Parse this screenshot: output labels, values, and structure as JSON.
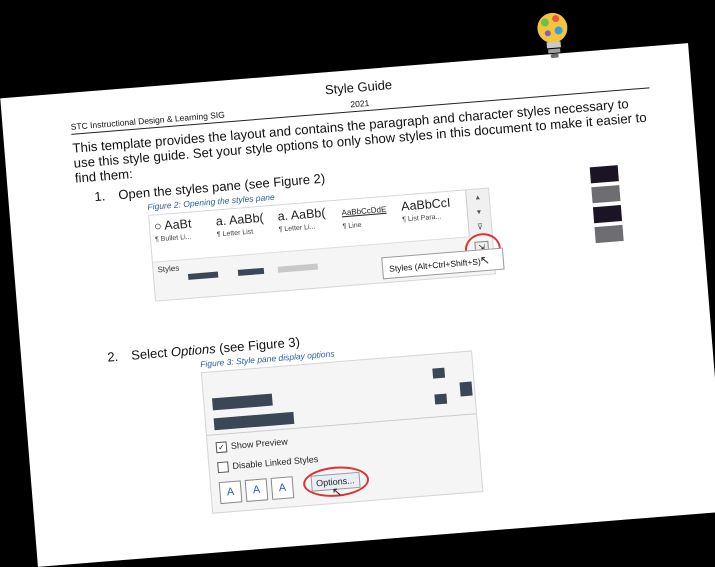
{
  "header": {
    "title": "Style Guide",
    "org": "STC Instructional Design & Learning SIG",
    "year": "2021"
  },
  "intro": "This template provides the layout and contains the paragraph and character styles necessary to use this style guide. Set your style options to only show styles in this document to make it easier to find them:",
  "steps": [
    {
      "num": "1.",
      "text": "Open the styles pane (see Figure 2)"
    },
    {
      "num": "2.",
      "text_prefix": "Select ",
      "text_em": "Options",
      "text_suffix": " (see Figure 3)"
    }
  ],
  "figure2": {
    "caption": "Figure 2: Opening the styles pane",
    "gallery": [
      {
        "sample": "○ AaBt",
        "label": "¶ Bullet Li..."
      },
      {
        "sample": "a. AaBb(",
        "label": "¶ Letter List"
      },
      {
        "sample": "a. AaBb(",
        "label": "¶ Letter Li..."
      },
      {
        "sample": "AaBbCcDdE",
        "label": "¶ Line"
      },
      {
        "sample": "AaBbCcI",
        "label": "¶ List Para..."
      }
    ],
    "styles_label": "Styles",
    "tooltip": "Styles (Alt+Ctrl+Shift+S)"
  },
  "figure3": {
    "caption": "Figure 3: Style pane display options",
    "show_preview": "Show Preview",
    "disable_linked": "Disable Linked Styles",
    "options_button": "Options..."
  },
  "colors": {
    "swatch_dark": "#1b1424",
    "swatch_gray": "#6e6e72",
    "accent_red": "#dd3333",
    "caption_blue": "#2b5b9e"
  }
}
